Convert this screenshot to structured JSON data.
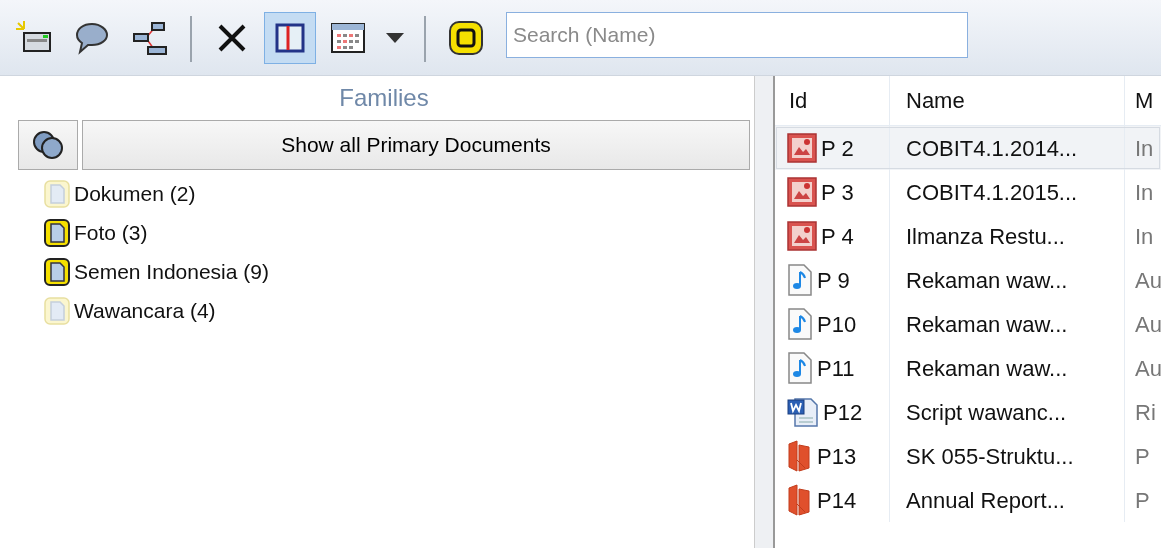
{
  "toolbar": {
    "groups": [
      [
        {
          "kind": "new-document",
          "selected": false
        },
        {
          "kind": "comment",
          "selected": false
        },
        {
          "kind": "network",
          "selected": false
        }
      ],
      [
        {
          "kind": "delete",
          "selected": false
        },
        {
          "kind": "pane",
          "selected": true
        },
        {
          "kind": "calendar",
          "selected": false
        },
        {
          "kind": "dropdown",
          "selected": false
        }
      ],
      [
        {
          "kind": "family-filter",
          "selected": false
        }
      ]
    ],
    "search": {
      "placeholder": "Search (Name)"
    }
  },
  "families": {
    "title": "Families",
    "show_all_button": "Show all Primary Documents",
    "items": [
      {
        "label": "Dokumen (2)",
        "active": false
      },
      {
        "label": "Foto (3)",
        "active": true
      },
      {
        "label": "Semen Indonesia (9)",
        "active": true
      },
      {
        "label": "Wawancara (4)",
        "active": false
      }
    ]
  },
  "table": {
    "columns": [
      "Id",
      "Name",
      "M"
    ],
    "rows": [
      {
        "kind": "image",
        "id": "P 2",
        "name": "COBIT4.1.2014...",
        "column_3": "In",
        "selected": true
      },
      {
        "kind": "image",
        "id": "P 3",
        "name": "COBIT4.1.2015...",
        "column_3": "In",
        "selected": false
      },
      {
        "kind": "image",
        "id": "P 4",
        "name": "Ilmanza Restu...",
        "column_3": "In",
        "selected": false
      },
      {
        "kind": "audio",
        "id": "P 9",
        "name": "Rekaman waw...",
        "column_3": "Au",
        "selected": false
      },
      {
        "kind": "audio",
        "id": "P10",
        "name": "Rekaman waw...",
        "column_3": "Au",
        "selected": false
      },
      {
        "kind": "audio",
        "id": "P11",
        "name": "Rekaman waw...",
        "column_3": "Au",
        "selected": false
      },
      {
        "kind": "word",
        "id": "P12",
        "name": "Script wawanc...",
        "column_3": "Ri",
        "selected": false
      },
      {
        "kind": "pdf",
        "id": "P13",
        "name": "SK 055-Struktu...",
        "column_3": "P",
        "selected": false
      },
      {
        "kind": "pdf",
        "id": "P14",
        "name": "Annual Report...",
        "column_3": "P",
        "selected": false
      }
    ]
  }
}
